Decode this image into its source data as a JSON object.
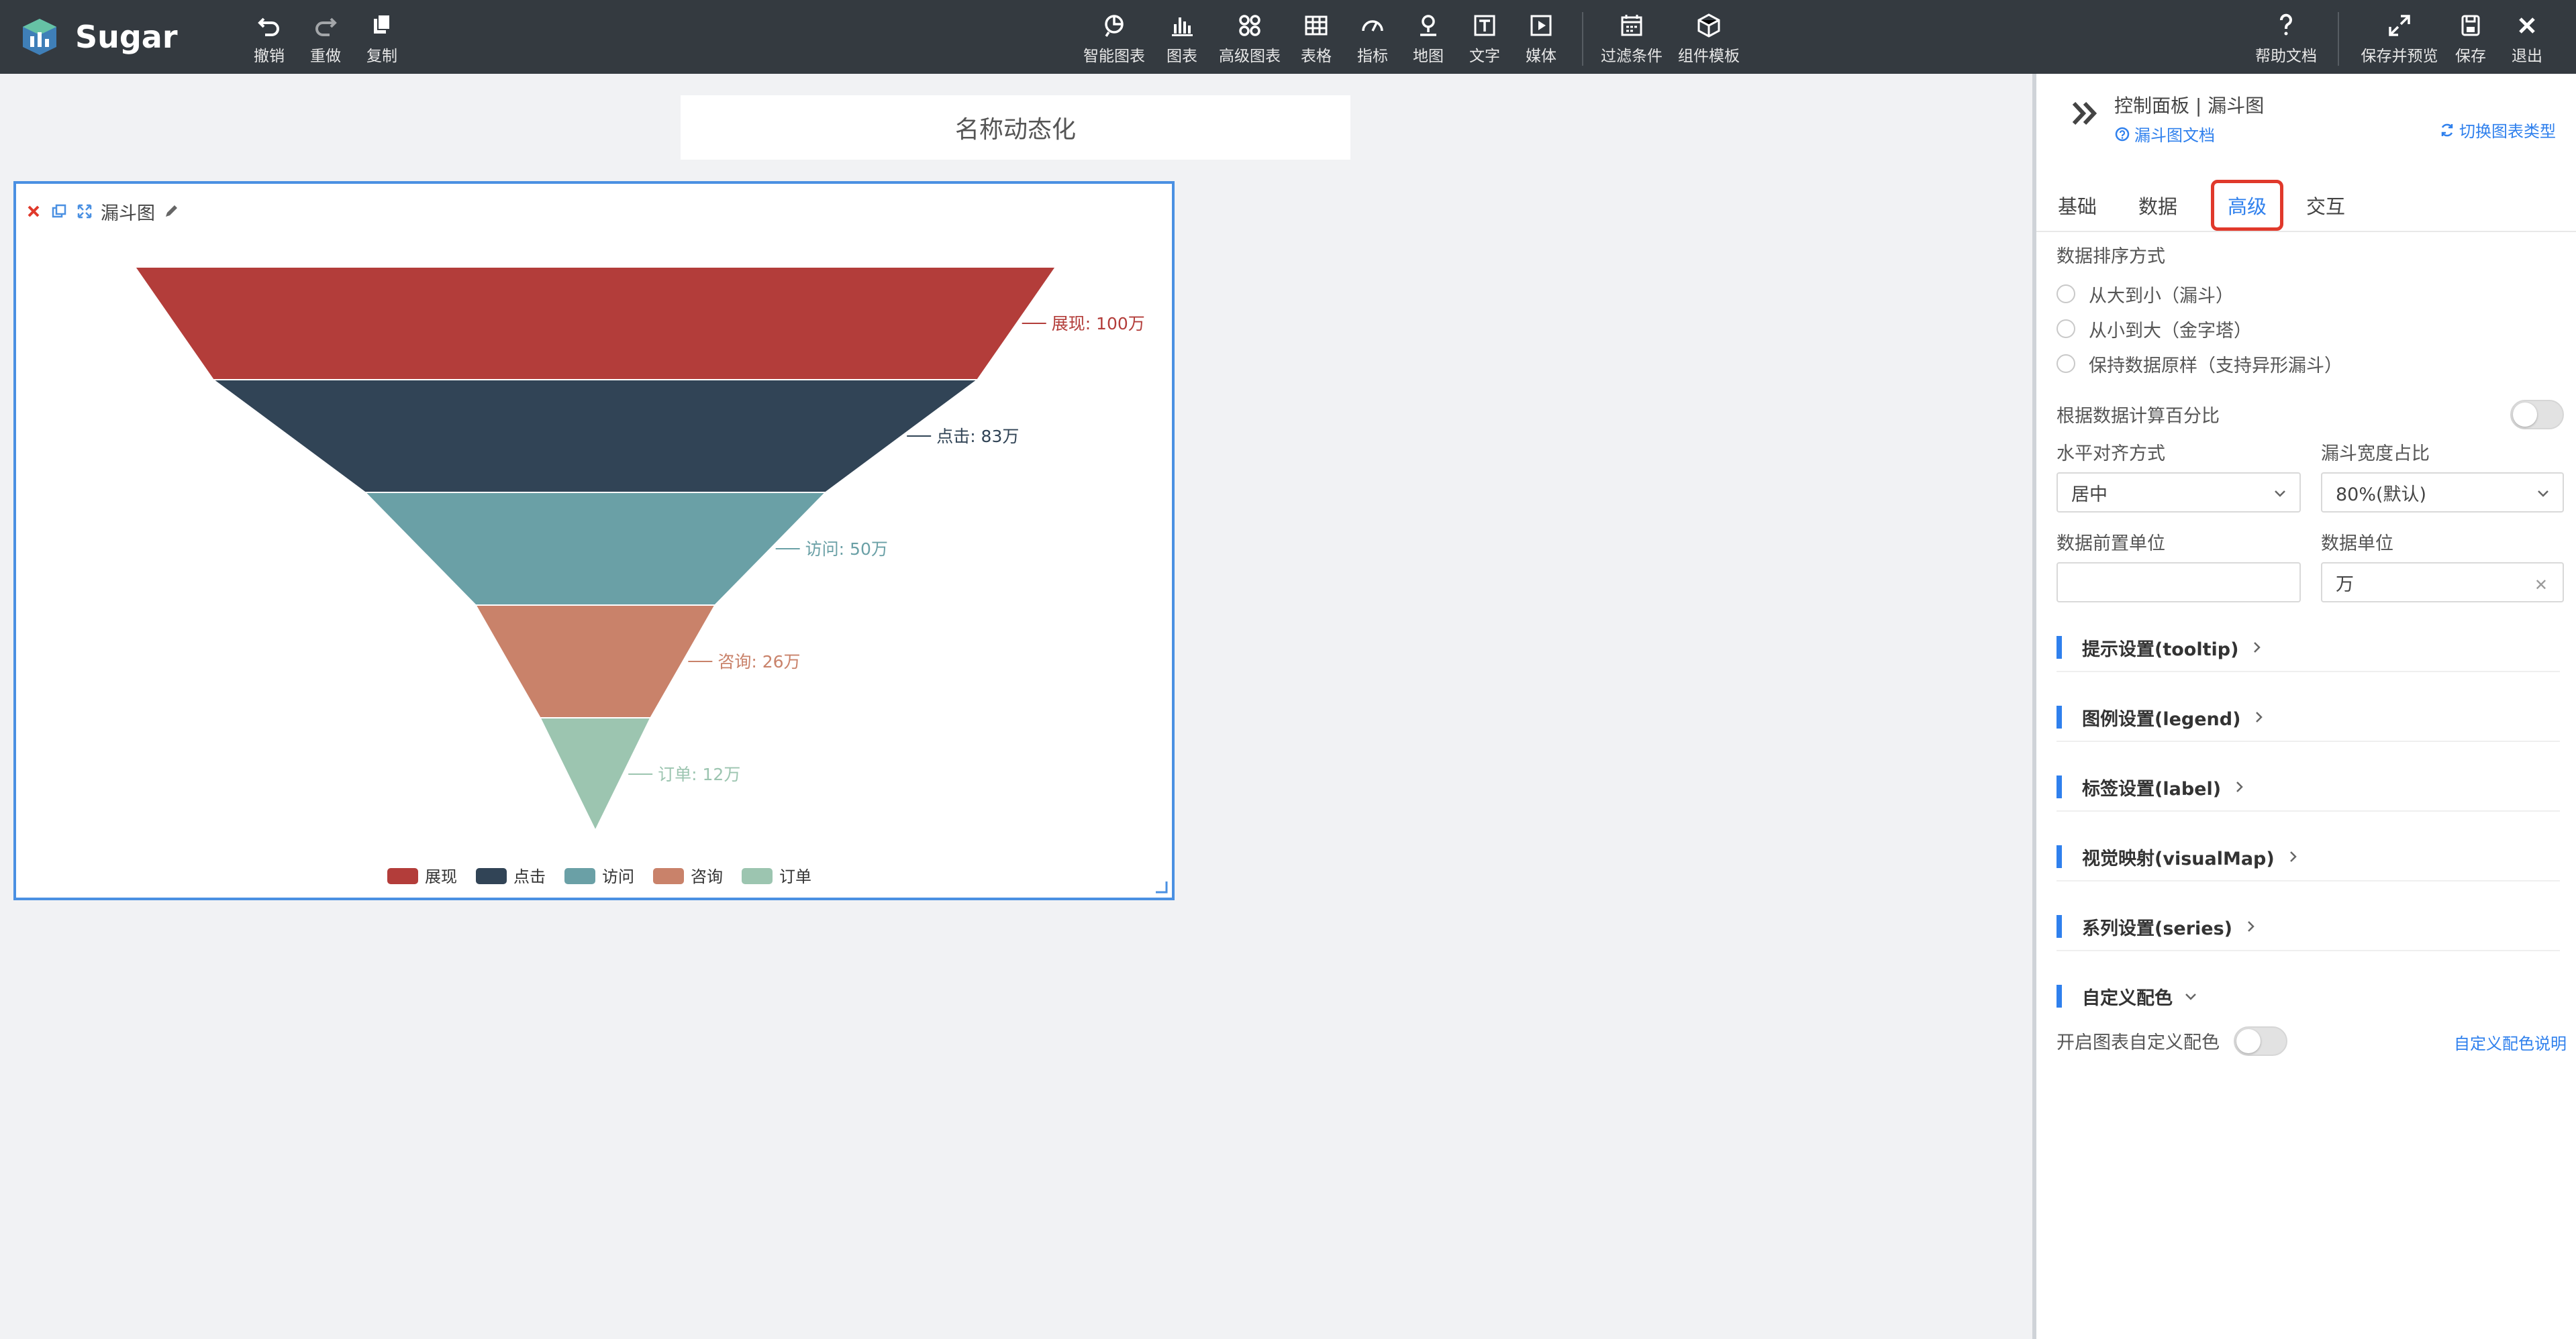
{
  "app": {
    "name": "Sugar"
  },
  "toolbar": {
    "undo": "撤销",
    "redo": "重做",
    "copy": "复制",
    "smart_chart": "智能图表",
    "chart": "图表",
    "advanced_chart": "高级图表",
    "table": "表格",
    "metric": "指标",
    "map": "地图",
    "text": "文字",
    "media": "媒体",
    "filter": "过滤条件",
    "template": "组件模板",
    "help": "帮助文档",
    "save_preview": "保存并预览",
    "save": "保存",
    "exit": "退出"
  },
  "canvas": {
    "title": "名称动态化",
    "card_title": "漏斗图"
  },
  "chart_data": {
    "type": "funnel",
    "categories": [
      "展现",
      "点击",
      "访问",
      "咨询",
      "订单"
    ],
    "values": [
      100,
      83,
      50,
      26,
      12
    ],
    "unit": "万",
    "labels": [
      "展现: 100万",
      "点击: 83万",
      "访问: 50万",
      "咨询: 26万",
      "订单: 12万"
    ],
    "colors": [
      "#b33d3a",
      "#314456",
      "#6aa0a6",
      "#c9826a",
      "#9cc5b0"
    ],
    "legend": [
      "展现",
      "点击",
      "访问",
      "咨询",
      "订单"
    ],
    "legend_position": "bottom"
  },
  "panel": {
    "title": "控制面板 | 漏斗图",
    "doc_link": "漏斗图文档",
    "switch_link": "切换图表类型",
    "tabs": [
      "基础",
      "数据",
      "高级",
      "交互"
    ],
    "active_tab": "高级",
    "sort_label": "数据排序方式",
    "sort_options": [
      "从大到小（漏斗）",
      "从小到大（金字塔）",
      "保持数据原样（支持异形漏斗）"
    ],
    "percent_label": "根据数据计算百分比",
    "align_label": "水平对齐方式",
    "align_value": "居中",
    "width_label": "漏斗宽度占比",
    "width_value": "80%(默认)",
    "prefix_label": "数据前置单位",
    "prefix_value": "",
    "unit_label": "数据单位",
    "unit_value": "万",
    "sections": [
      "提示设置(tooltip)",
      "图例设置(legend)",
      "标签设置(label)",
      "视觉映射(visualMap)",
      "系列设置(series)",
      "自定义配色"
    ],
    "custom_color_label": "开启图表自定义配色",
    "custom_color_link": "自定义配色说明"
  }
}
